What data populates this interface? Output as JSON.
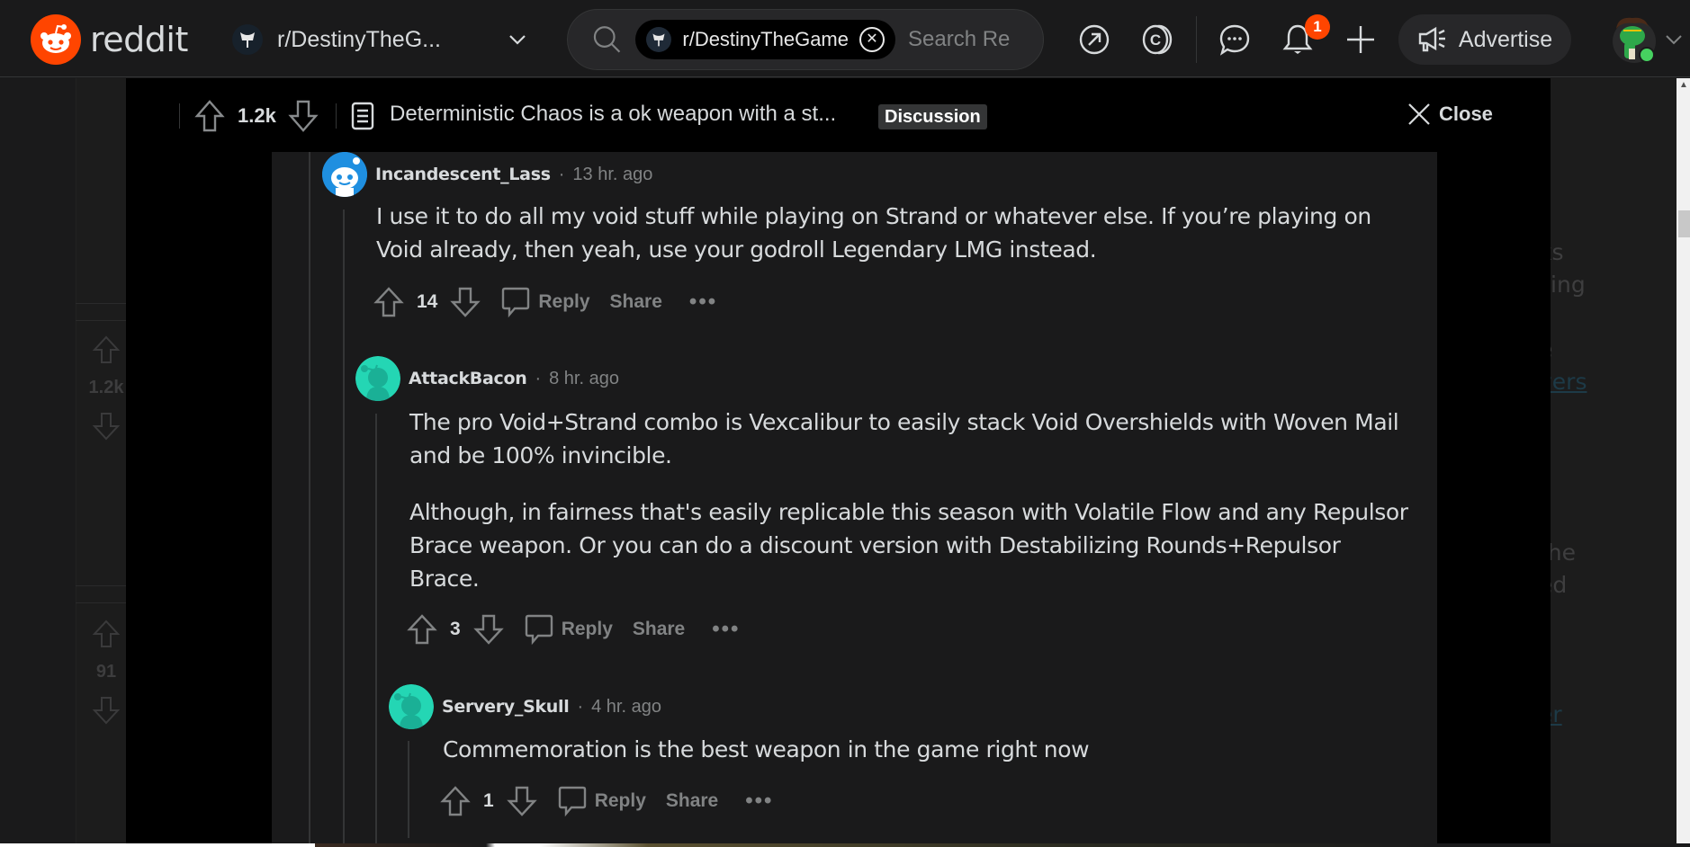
{
  "topnav": {
    "logo_text": "reddit",
    "community": "r/DestinyTheG...",
    "search": {
      "chip_label": "r/DestinyTheGame",
      "placeholder": "Search Re"
    },
    "notification_count": "1",
    "advertise_label": "Advertise",
    "icons": [
      "popular-icon",
      "coins-icon",
      "chat-icon",
      "notification-bell-icon",
      "create-post-icon"
    ]
  },
  "post": {
    "score": "1.2k",
    "title": "Deterministic Chaos is a ok weapon with a st...",
    "flair": "Discussion",
    "close_label": "Close"
  },
  "comments": [
    {
      "author": "Incandescent_Lass",
      "time": "13 hr. ago",
      "paragraphs": [
        "I use it to do all my void stuff while playing on Strand or whatever else. If you’re playing on Void already, then yeah, use your godroll Legendary LMG instead."
      ],
      "score": "14",
      "reply_label": "Reply",
      "share_label": "Share",
      "avatar_color": "#1f8fe0"
    },
    {
      "author": "AttackBacon",
      "time": "8 hr. ago",
      "paragraphs": [
        "The pro Void+Strand combo is Vexcalibur to easily stack Void Overshields with Woven Mail and be 100% invincible.",
        "Although, in fairness that's easily replicable this season with Volatile Flow and any Repulsor Brace weapon. Or you can do a discount version with Destabilizing Rounds+Repulsor Brace."
      ],
      "score": "3",
      "reply_label": "Reply",
      "share_label": "Share",
      "avatar_color": "#24d6b4"
    },
    {
      "author": "Servery_Skull",
      "time": "4 hr. ago",
      "paragraphs": [
        "Commemoration is the best weapon in the game right now"
      ],
      "score": "1",
      "reply_label": "Reply",
      "share_label": "Share",
      "avatar_color": "#24d6b4"
    }
  ],
  "background": {
    "left_scores": [
      "1.2k",
      "91"
    ],
    "right_text_fragments": [
      "t",
      "ks",
      "sing",
      "e",
      "vers",
      "t",
      "the",
      "ed",
      "_",
      "er"
    ]
  },
  "colors": {
    "brand": "#ff4500",
    "text": "#d7dadc",
    "muted": "#818384"
  }
}
